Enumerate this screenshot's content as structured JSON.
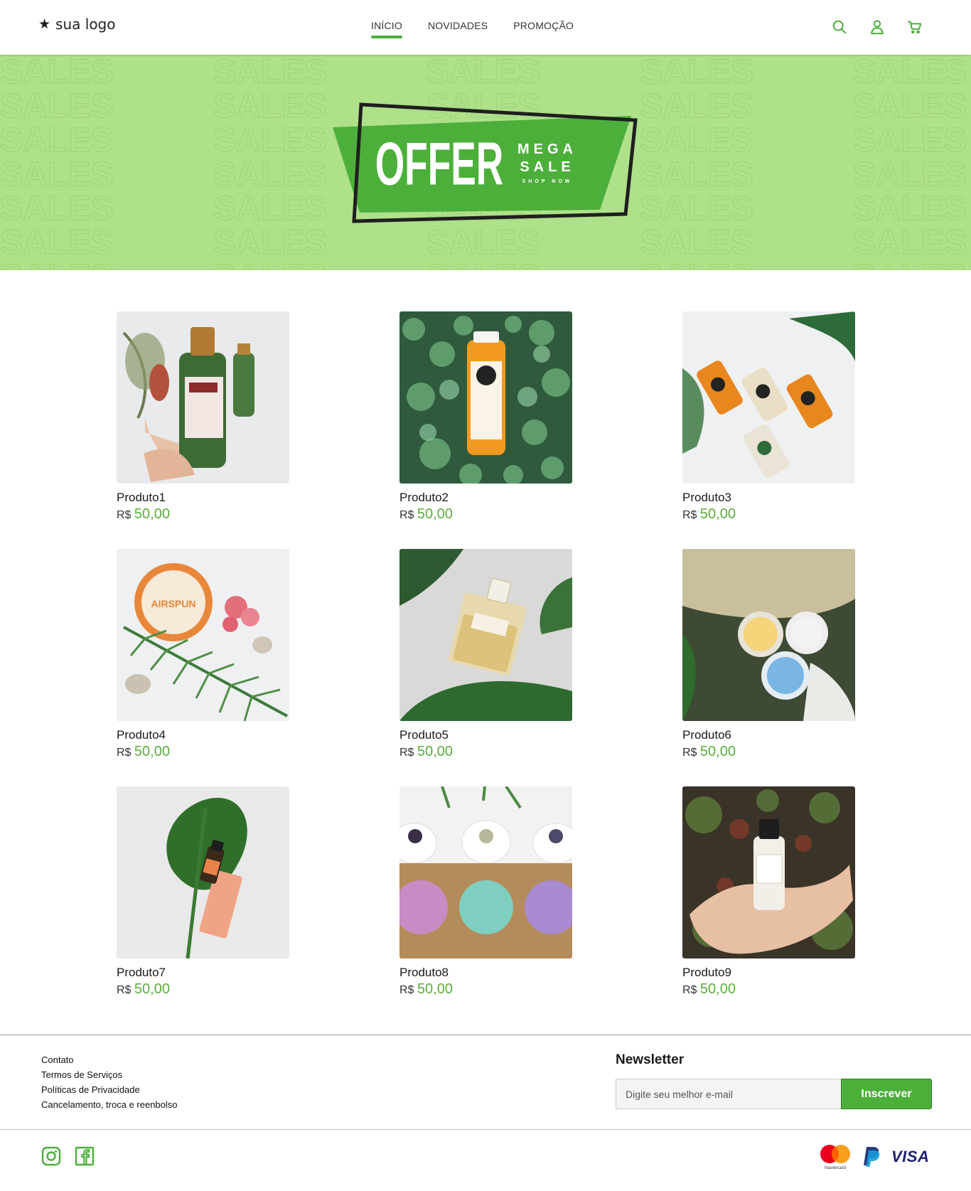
{
  "header": {
    "logo_text": "sua logo",
    "nav": [
      {
        "label": "INÍCIO",
        "active": true
      },
      {
        "label": "NOVIDADES",
        "active": false
      },
      {
        "label": "PROMOÇÃO",
        "active": false
      }
    ],
    "icons": [
      "search-icon",
      "user-icon",
      "cart-icon"
    ]
  },
  "banner": {
    "word": "OFFER",
    "line1": "MEGA",
    "line2": "SALE",
    "line3": "SHOP NOW",
    "background_text": "SALES",
    "colors": {
      "background": "#afe08a",
      "panel": "#4caf3a",
      "frame": "#1f1f1f"
    }
  },
  "products": [
    {
      "name": "Produto1",
      "currency": "R$",
      "price": "50,00"
    },
    {
      "name": "Produto2",
      "currency": "R$",
      "price": "50,00"
    },
    {
      "name": "Produto3",
      "currency": "R$",
      "price": "50,00"
    },
    {
      "name": "Produto4",
      "currency": "R$",
      "price": "50,00"
    },
    {
      "name": "Produto5",
      "currency": "R$",
      "price": "50,00"
    },
    {
      "name": "Produto6",
      "currency": "R$",
      "price": "50,00"
    },
    {
      "name": "Produto7",
      "currency": "R$",
      "price": "50,00"
    },
    {
      "name": "Produto8",
      "currency": "R$",
      "price": "50,00"
    },
    {
      "name": "Produto9",
      "currency": "R$",
      "price": "50,00"
    }
  ],
  "footer": {
    "links": [
      "Contato",
      "Termos de Serviços",
      "Políticas de Privacidade",
      "Cancelamento, troca e reenbolso"
    ],
    "newsletter": {
      "title": "Newsletter",
      "placeholder": "Digite seu melhor e-mail",
      "button": "Inscrever"
    },
    "social": [
      "instagram-icon",
      "facebook-icon"
    ],
    "payments": [
      "mastercard",
      "paypal",
      "VISA"
    ]
  },
  "colors": {
    "accent": "#4caf3a",
    "price": "#5aae3b"
  }
}
